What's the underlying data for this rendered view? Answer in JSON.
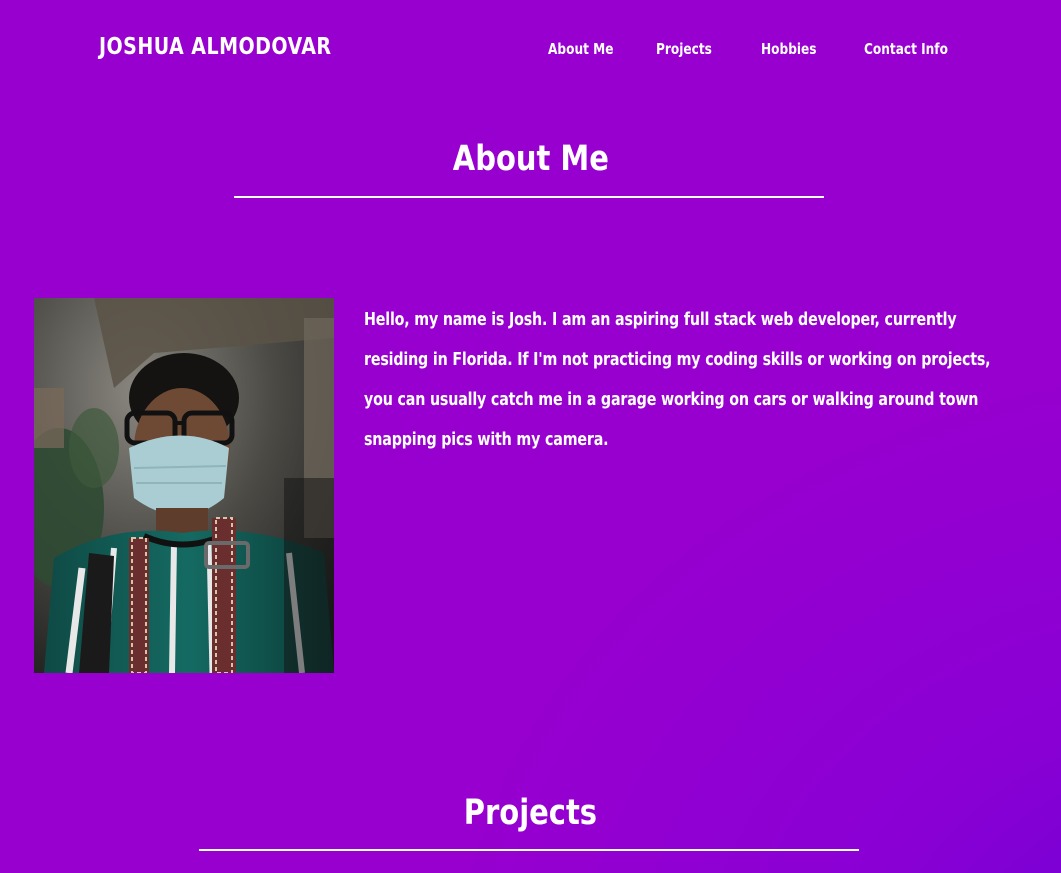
{
  "header": {
    "brand": "JOSHUA ALMODOVAR",
    "nav": [
      "About Me",
      "Projects",
      "Hobbies",
      "Contact Info"
    ]
  },
  "about": {
    "title": "About Me",
    "photo_alt": "photo of Josh",
    "bio": "Hello, my name is Josh. I am an aspiring full stack web developer, currently residing in Florida. If I'm not practicing my coding skills or working on projects, you can usually catch me in a garage working on cars or walking around town snapping pics with my camera."
  },
  "projects": {
    "title": "Projects"
  },
  "colors": {
    "background": "#9700cf",
    "background_corner": "#6a00d4",
    "text": "#ffffff"
  }
}
